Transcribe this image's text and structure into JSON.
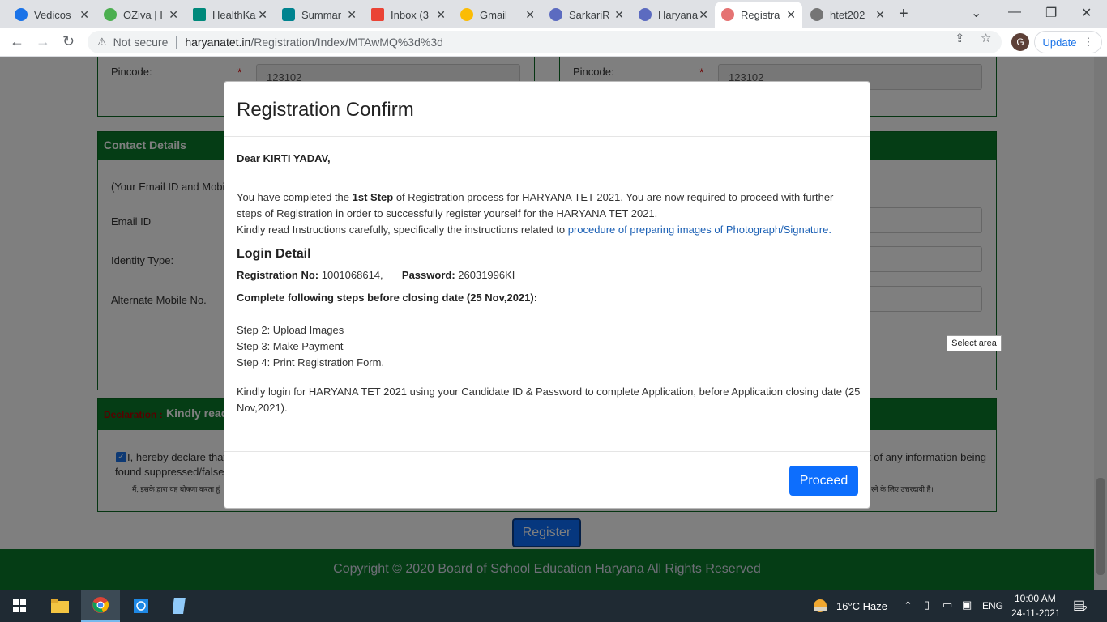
{
  "browser": {
    "tabs": [
      {
        "title": "Vedicos",
        "color": "#1a73e8"
      },
      {
        "title": "OZiva | I",
        "color": "#4caf50"
      },
      {
        "title": "HealthKa",
        "color": "#00897b"
      },
      {
        "title": "Summar",
        "color": "#00838f"
      },
      {
        "title": "Inbox (3",
        "color": "#ea4335"
      },
      {
        "title": "Gmail",
        "color": "#fbbc05"
      },
      {
        "title": "SarkariR",
        "color": "#5c6bc0"
      },
      {
        "title": "Haryana",
        "color": "#5c6bc0"
      },
      {
        "title": "Registra",
        "color": "#e57373"
      },
      {
        "title": "htet202",
        "color": "#757575"
      }
    ],
    "new_tab": "+",
    "security_label": "Not secure",
    "url_host": "haryanatet.in",
    "url_path": "/Registration/Index/MTAwMQ%3d%3d",
    "profile_initial": "G",
    "update_label": "Update"
  },
  "form": {
    "pincode_label": "Pincode:",
    "pincode_value": "123102",
    "pincode_label_right": "Pincode:",
    "pincode_value_right": "123102",
    "contact_title": "Contact Details",
    "contact_note": "(Your Email ID and Mobi",
    "email_label": "Email ID",
    "identity_label": "Identity Type:",
    "alt_mobile_label": "Alternate Mobile No.",
    "declaration_red": "Declaration :",
    "declaration_white": "Kindly read",
    "declare_text_1": "I, hereby declare that",
    "declare_text_2": "found suppressed/false",
    "declare_text_right": "t of any information being",
    "declare_hindi": "मैं, इसके द्वारा यह घोषणा करता हूं",
    "declare_hindi_right": "रने के लिए उत्तरदायी है।",
    "register_label": "Register",
    "copyright": "Copyright © 2020 Board of School Education Haryana All Rights Reserved"
  },
  "modal": {
    "title": "Registration Confirm",
    "greeting": "Dear KIRTI YADAV,",
    "para1_before": "You have completed the ",
    "para1_bold": "1st Step",
    "para1_after": " of Registration process for HARYANA TET 2021. You are now required to proceed with further steps of Registration in order to successfully register yourself for the HARYANA TET 2021.",
    "para2_before": "Kindly read Instructions carefully, specifically the instructions related to ",
    "para2_link": "procedure of preparing images of Photograph/Signature.",
    "login_title": "Login Detail",
    "reg_no_label": "Registration No:",
    "reg_no_value": " 1001068614,",
    "password_label": "Password:",
    "password_value": " 26031996KI",
    "steps_heading": "Complete following steps before closing date (25 Nov,2021):",
    "steps": [
      "Step 2: Upload Images",
      "Step 3: Make Payment",
      "Step 4: Print Registration Form."
    ],
    "closing_note": "Kindly login for HARYANA TET 2021 using your Candidate ID & Password to complete Application, before Application closing date (25 Nov,2021).",
    "proceed_label": "Proceed"
  },
  "tooltip": "Select area",
  "taskbar": {
    "weather": "16°C  Haze",
    "language": "ENG",
    "time": "10:00 AM",
    "date": "24-11-2021",
    "notifications": "2"
  }
}
